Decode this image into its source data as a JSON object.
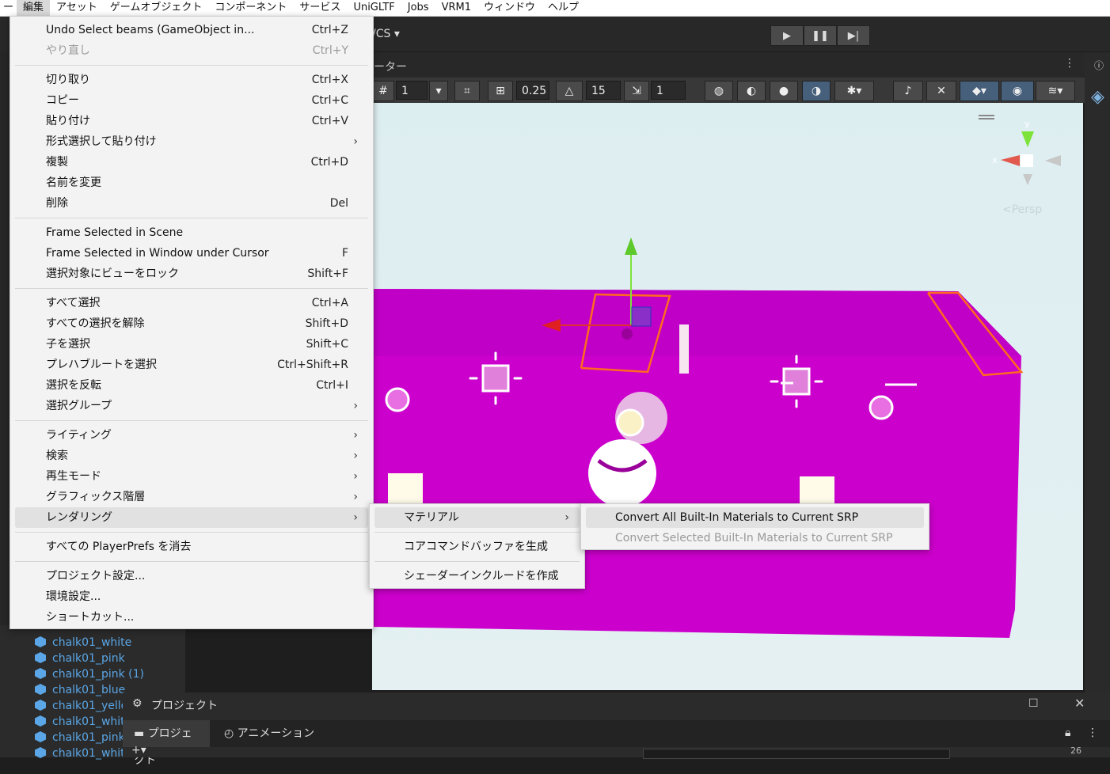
{
  "menubar": {
    "items": [
      "編集",
      "アセット",
      "ゲームオブジェクト",
      "コンポーネント",
      "サービス",
      "UniGLTF",
      "Jobs",
      "VRM1",
      "ウィンドウ",
      "ヘルプ"
    ]
  },
  "toolbar": {
    "vcs_label": "/CS ▾"
  },
  "scene": {
    "tab_fragment": "ーター",
    "grid_value": "1",
    "snap_value": "0.25",
    "angle_value": "15",
    "scale_value": "1",
    "persp_label": "<Persp",
    "gizmo_x": "x",
    "gizmo_y": "y"
  },
  "edit_menu": {
    "items": [
      {
        "label": "Undo Select beams (GameObject in...",
        "shortcut": "Ctrl+Z"
      },
      {
        "label": "やり直し",
        "shortcut": "Ctrl+Y",
        "disabled": true
      },
      {
        "label": "切り取り",
        "shortcut": "Ctrl+X"
      },
      {
        "label": "コピー",
        "shortcut": "Ctrl+C"
      },
      {
        "label": "貼り付け",
        "shortcut": "Ctrl+V"
      },
      {
        "label": "形式選択して貼り付け",
        "shortcut": "",
        "submenu": true
      },
      {
        "label": "複製",
        "shortcut": "Ctrl+D"
      },
      {
        "label": "名前を変更",
        "shortcut": ""
      },
      {
        "label": "削除",
        "shortcut": "Del"
      },
      {
        "label": "Frame Selected in Scene",
        "shortcut": ""
      },
      {
        "label": "Frame Selected in Window under Cursor",
        "shortcut": "F"
      },
      {
        "label": "選択対象にビューをロック",
        "shortcut": "Shift+F"
      },
      {
        "label": "すべて選択",
        "shortcut": "Ctrl+A"
      },
      {
        "label": "すべての選択を解除",
        "shortcut": "Shift+D"
      },
      {
        "label": "子を選択",
        "shortcut": "Shift+C"
      },
      {
        "label": "プレハブルートを選択",
        "shortcut": "Ctrl+Shift+R"
      },
      {
        "label": "選択を反転",
        "shortcut": "Ctrl+I"
      },
      {
        "label": "選択グループ",
        "shortcut": "",
        "submenu": true
      },
      {
        "label": "ライティング",
        "shortcut": "",
        "submenu": true
      },
      {
        "label": "検索",
        "shortcut": "",
        "submenu": true
      },
      {
        "label": "再生モード",
        "shortcut": "",
        "submenu": true
      },
      {
        "label": "グラフィックス階層",
        "shortcut": "",
        "submenu": true
      },
      {
        "label": "レンダリング",
        "shortcut": "",
        "submenu": true,
        "highlighted": true
      },
      {
        "label": "すべての PlayerPrefs を消去",
        "shortcut": ""
      },
      {
        "label": "プロジェクト設定...",
        "shortcut": ""
      },
      {
        "label": "環境設定...",
        "shortcut": ""
      },
      {
        "label": "ショートカット...",
        "shortcut": ""
      }
    ]
  },
  "rendering_menu": {
    "items": [
      {
        "label": "マテリアル",
        "submenu": true,
        "highlighted": true
      },
      {
        "label": "コアコマンドバッファを生成"
      },
      {
        "label": "シェーダーインクルードを作成"
      }
    ]
  },
  "material_menu": {
    "items": [
      {
        "label": "Convert All Built-In Materials to Current SRP",
        "highlighted": true
      },
      {
        "label": "Convert Selected Built-In Materials to Current SRP",
        "disabled": true
      }
    ]
  },
  "hierarchy": {
    "rows": [
      "chalk01_white",
      "chalk01_pink",
      "chalk01_pink (1)",
      "chalk01_blue",
      "chalk01_yello",
      "chalk01_whit",
      "chalk01_pink",
      "chalk01_whit"
    ]
  },
  "bottom": {
    "window_title": "プロジェクト",
    "tab_project": "プロジェクト",
    "tab_animation": "アニメーション",
    "count": "26"
  },
  "colors": {
    "accent": "#cc00cc",
    "menu_bg": "#f3f3f3",
    "highlight": "#e1e1e1",
    "hierarchy_text": "#5aa6e6"
  }
}
